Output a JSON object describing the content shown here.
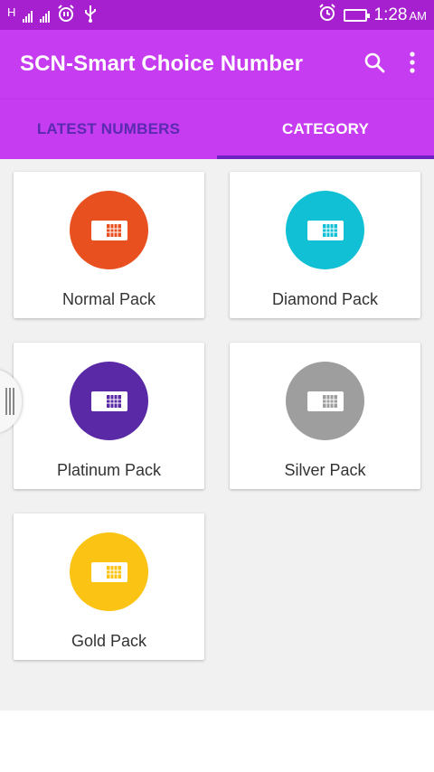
{
  "status_bar": {
    "network_type": "H",
    "time": "1:28",
    "am_pm": "AM",
    "icons": [
      "signal-icon",
      "signal-icon",
      "alarm-icon",
      "usb-icon",
      "alarm-icon",
      "battery-charging-icon"
    ]
  },
  "app_bar": {
    "title": "SCN-Smart Choice Number",
    "actions": [
      "search-icon",
      "more-vert-icon"
    ]
  },
  "tabs": [
    {
      "label": "LATEST NUMBERS",
      "active": false
    },
    {
      "label": "CATEGORY",
      "active": true
    }
  ],
  "categories": [
    {
      "label": "Normal Pack",
      "color": "#e8501f"
    },
    {
      "label": "Diamond Pack",
      "color": "#12c0d5"
    },
    {
      "label": "Platinum Pack",
      "color": "#5a2aa6"
    },
    {
      "label": "Silver Pack",
      "color": "#9e9e9e"
    },
    {
      "label": "Gold Pack",
      "color": "#fbc313"
    }
  ],
  "colors": {
    "status_bar": "#a620cf",
    "app_bar": "#c63cf0",
    "tab_indicator": "#6e22c4",
    "background": "#f1f1f1"
  }
}
